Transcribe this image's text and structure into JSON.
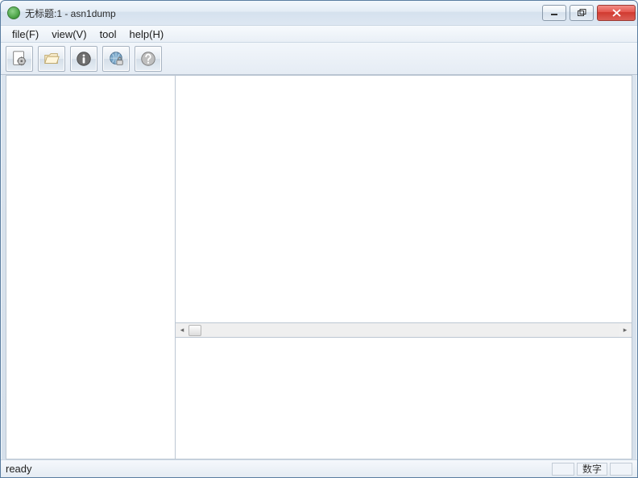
{
  "window": {
    "title": "无标题:1 - asn1dump"
  },
  "menu": {
    "file": "file(F)",
    "view": "view(V)",
    "tool": "tool",
    "help": "help(H)"
  },
  "toolbar": {
    "buttons": [
      {
        "name": "doc-gear-icon"
      },
      {
        "name": "folder-open-icon"
      },
      {
        "name": "info-circle-icon"
      },
      {
        "name": "globe-lock-icon"
      },
      {
        "name": "help-circle-icon"
      }
    ]
  },
  "status": {
    "text": "ready",
    "numlock": "数字"
  }
}
